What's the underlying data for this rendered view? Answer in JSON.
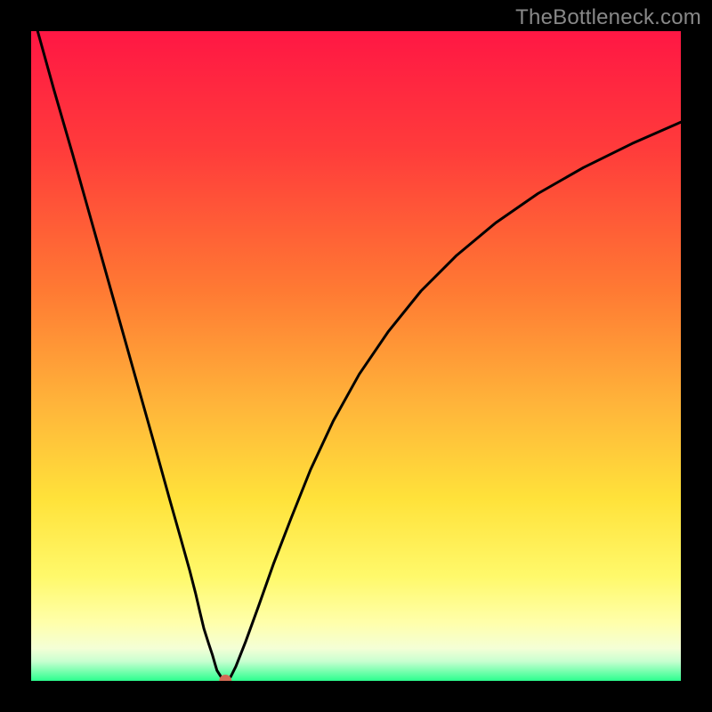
{
  "watermark": {
    "text": "TheBottleneck.com"
  },
  "chart_data": {
    "type": "line",
    "title": "",
    "xlabel": "",
    "ylabel": "",
    "xlim": [
      0,
      100
    ],
    "ylim": [
      0,
      100
    ],
    "gradient_stops": [
      {
        "offset": 0,
        "color": "#ff1744"
      },
      {
        "offset": 18,
        "color": "#ff3b3b"
      },
      {
        "offset": 40,
        "color": "#ff7a33"
      },
      {
        "offset": 58,
        "color": "#ffb63a"
      },
      {
        "offset": 72,
        "color": "#ffe23a"
      },
      {
        "offset": 84,
        "color": "#fff96b"
      },
      {
        "offset": 91,
        "color": "#ffffaa"
      },
      {
        "offset": 95,
        "color": "#f4ffd6"
      },
      {
        "offset": 97,
        "color": "#c8ffd0"
      },
      {
        "offset": 100,
        "color": "#2bff8e"
      }
    ],
    "series": [
      {
        "name": "bottleneck-curve",
        "x": [
          1.0,
          3.5,
          6.4,
          9.5,
          12.6,
          15.7,
          18.8,
          21.3,
          23.0,
          24.4,
          25.3,
          26.0,
          26.6,
          27.3,
          27.9,
          28.3,
          28.6,
          29.3,
          29.9,
          30.7,
          31.5,
          33.0,
          35.0,
          37.3,
          40.0,
          43.0,
          46.5,
          50.5,
          55.0,
          60.0,
          65.5,
          71.5,
          78.0,
          85.0,
          92.5,
          100.0
        ],
        "values": [
          100.0,
          91.0,
          81.0,
          70.0,
          59.0,
          48.0,
          37.0,
          28.0,
          22.0,
          17.0,
          13.5,
          10.5,
          8.0,
          5.8,
          4.0,
          2.6,
          1.6,
          0.5,
          0.0,
          0.6,
          2.2,
          6.0,
          11.5,
          18.0,
          25.0,
          32.5,
          40.0,
          47.2,
          53.8,
          60.0,
          65.5,
          70.5,
          75.0,
          79.0,
          82.7,
          86.0
        ]
      }
    ],
    "marker": {
      "x": 29.9,
      "y": 0.0,
      "color": "#d46b55",
      "radius_px": 7
    }
  }
}
